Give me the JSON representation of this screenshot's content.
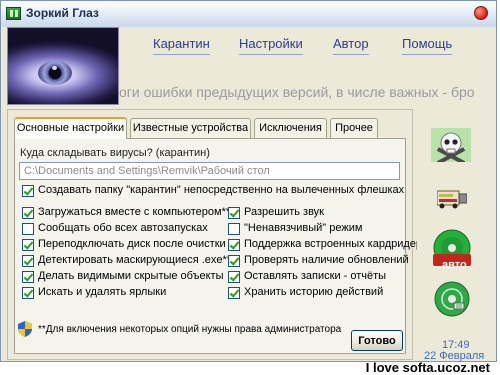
{
  "window": {
    "title": "Зоркий Глаз"
  },
  "nav": {
    "items": [
      "Карантин",
      "Настройки",
      "Автор",
      "Помощь"
    ]
  },
  "ticker": "оги ошибки предыдущих версий, в числе важных - бро",
  "tabs": [
    {
      "label": "Основные настройки",
      "active": true
    },
    {
      "label": "Известные устройства",
      "active": false
    },
    {
      "label": "Исключения",
      "active": false
    },
    {
      "label": "Прочее",
      "active": false
    }
  ],
  "quarantine": {
    "label": "Куда складывать вирусы? (карантин)",
    "path": "C:\\Documents and Settings\\Remvik\\Рабочий стол"
  },
  "options": [
    {
      "label": "Создавать папку \"карантин\" непосредственно на вылеченных флешках",
      "checked": true
    },
    {
      "label": "Загружаться вместе с компьютером**",
      "checked": true
    },
    {
      "label": "Сообщать обо всех автозапусках",
      "checked": false
    },
    {
      "label": "Переподключать диск после очистки",
      "checked": true
    },
    {
      "label": "Детектировать маскирующиеся .exe**",
      "checked": true
    },
    {
      "label": "Делать видимыми скрытые объекты",
      "checked": true
    },
    {
      "label": "Искать и удалять ярлыки",
      "checked": true
    },
    {
      "label": "Разрешить звук",
      "checked": true
    },
    {
      "label": "\"Ненавязчивый\" режим",
      "checked": false
    },
    {
      "label": "Поддержка встроенных кардридеров",
      "checked": true
    },
    {
      "label": "Проверять наличие обновлений",
      "checked": true
    },
    {
      "label": "Оставлять записки - отчёты",
      "checked": true
    },
    {
      "label": "Хранить историю действий",
      "checked": true
    }
  ],
  "note": "**Для включения некоторых опций нужны права администратора",
  "ok_button": "Готово",
  "side": {
    "auto_label": "авто"
  },
  "clock": {
    "time": "17:49",
    "date": "22 Февраля"
  },
  "watermark": "I love softa.ucoz.net",
  "icons": [
    "skull-icon",
    "usb-device-icon",
    "autorun-disc-icon",
    "refresh-disc-icon",
    "admin-shield-icon",
    "app-icon",
    "close-icon"
  ],
  "colors": {
    "nav_text": "#2a3d8f",
    "check": "#21a121",
    "clock": "#3a6bc7",
    "tab_accent": "#e6a22e"
  }
}
